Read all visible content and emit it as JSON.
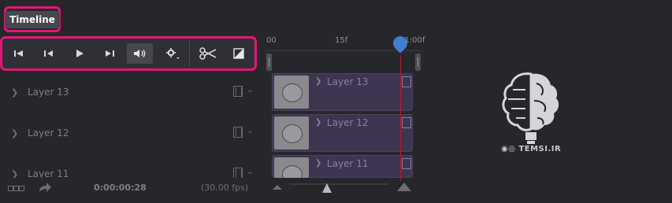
{
  "panel": {
    "title": "Timeline"
  },
  "toolbar": {
    "buttons": [
      {
        "name": "first-frame-button",
        "icon": "skip-to-start-icon"
      },
      {
        "name": "prev-frame-button",
        "icon": "step-back-icon"
      },
      {
        "name": "play-button",
        "icon": "play-icon"
      },
      {
        "name": "next-frame-button",
        "icon": "step-forward-icon"
      },
      {
        "name": "audio-toggle-button",
        "icon": "speaker-icon",
        "active": true
      },
      {
        "name": "settings-button",
        "icon": "gear-icon"
      },
      {
        "name": "split-button",
        "icon": "scissors-icon"
      },
      {
        "name": "transition-button",
        "icon": "transition-icon"
      }
    ]
  },
  "ruler": {
    "labels": [
      "00",
      "15f",
      "01:00f"
    ]
  },
  "layers": [
    {
      "name": "Layer 13"
    },
    {
      "name": "Layer 12"
    },
    {
      "name": "Layer 11"
    }
  ],
  "footer": {
    "timecode": "0:00:00:28",
    "fps": "(30.00 fps)"
  },
  "watermark": {
    "text": "TEMSI.IR"
  },
  "colors": {
    "accent_highlight": "#e5157a",
    "playhead": "#3f7fd0",
    "clip": "#3e3550",
    "background": "#26272b"
  }
}
